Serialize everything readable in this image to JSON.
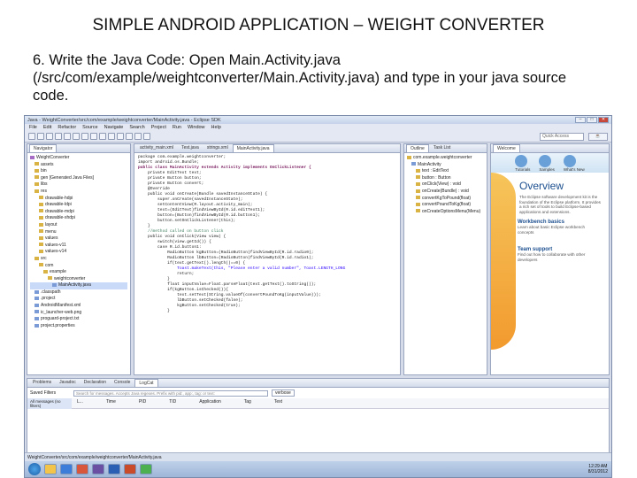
{
  "slide": {
    "title": "SIMPLE ANDROID APPLICATION – WEIGHT CONVERTER",
    "body": "6. Write the Java Code: Open Main.Activity.java (/src/com/example/weightconverter/Main.Activity.java) and type in your java source code."
  },
  "ide": {
    "window_title": "Java - WeightConverter/src/com/example/weightconverter/MainActivity.java - Eclipse SDK",
    "menus": [
      "File",
      "Edit",
      "Refactor",
      "Source",
      "Navigate",
      "Search",
      "Project",
      "Run",
      "Window",
      "Help"
    ],
    "quick_access_placeholder": "Quick Access",
    "navigator": {
      "tab": "Navigator",
      "items": [
        "WeightConverter",
        "assets",
        "bin",
        "gen [Generated Java Files]",
        "libs",
        "res",
        "drawable-hdpi",
        "drawable-ldpi",
        "drawable-mdpi",
        "drawable-xhdpi",
        "layout",
        "menu",
        "values",
        "values-v11",
        "values-v14",
        "src",
        "com",
        "example",
        "weightconverter",
        "MainActivity.java",
        ".classpath",
        ".project",
        "AndroidManifest.xml",
        "ic_launcher-web.png",
        "proguard-project.txt",
        "project.properties"
      ]
    },
    "editor": {
      "tabs": [
        "activity_main.xml",
        "Test.java",
        "strings.xml",
        "MainActivity.java"
      ],
      "lines": [
        "package com.example.weightconverter;",
        "",
        "import android.os.Bundle;",
        "",
        "public class MainActivity extends Activity implements OnClickListener {",
        "    private EditText text;",
        "    private Button button;",
        "    private Button convert;",
        "    @Override",
        "    public void onCreate(Bundle savedInstanceState) {",
        "        super.onCreate(savedInstanceState);",
        "        setContentView(R.layout.activity_main);",
        "        text=(EditText)findViewById(R.id.editText1);",
        "        button=(Button)findViewById(R.id.button1);",
        "        button.setOnClickListener(this);",
        "    }",
        "    //method called on button click",
        "    public void onClick(View view) {",
        "",
        "        switch(view.getId()) {",
        "        case R.id.button1:",
        "            RadioButton kgButton=(RadioButton)findViewById(R.id.radio0);",
        "            RadioButton lbButton=(RadioButton)findViewById(R.id.radio1);",
        "            if(text.getText().length()==0) {",
        "                Toast.makeText(this, \"Please enter a valid number\", Toast.LENGTH_LONG",
        "                return;",
        "            }",
        "            float inputValue=Float.parseFloat(text.getText().toString());",
        "            if(kgButton.isChecked()){",
        "                text.setText(String.valueOf(convertPoundToKg(inputValue)));",
        "                lbButton.setChecked(false);",
        "                kgButton.setChecked(true);",
        "            }"
      ]
    },
    "outline": {
      "tabs": [
        "Outline",
        "Task List"
      ],
      "items": [
        "com.example.weightconverter",
        "MainActivity",
        "text : EditText",
        "button : Button",
        "onClick(View) : void",
        "onCreate(Bundle) : void",
        "convertKgToPound(float)",
        "convertPoundToKg(float)",
        "onCreateOptionsMenu(Menu)"
      ]
    },
    "welcome": {
      "tab": "Welcome",
      "links": [
        "Tutorials",
        "Samples",
        "What's New"
      ],
      "overview_title": "Overview",
      "overview_text": "The Eclipse software development kit is the foundation of the Eclipse platform. It provides a rich set of tools to build Eclipse-based applications and extensions.",
      "items": [
        {
          "title": "Workbench basics",
          "desc": "Learn about basic Eclipse workbench concepts"
        },
        {
          "title": "Team support",
          "desc": "Find out how to collaborate with other developers"
        }
      ]
    },
    "bottom": {
      "tabs": [
        "Problems",
        "Javadoc",
        "Declaration",
        "Console",
        "LogCat"
      ],
      "filter_label": "Saved Filters",
      "filter_item": "All messages (no filters)",
      "search_placeholder": "Search for messages. Accepts Java regexes. Prefix with pid:, app:, tag: or text:",
      "level": "verbose",
      "columns": [
        "L...",
        "Time",
        "PID",
        "TID",
        "Application",
        "Tag",
        "Text"
      ]
    },
    "status": "WeightConverter/src/com/example/weightconverter/MainActivity.java",
    "clock_time": "12:29 AM",
    "clock_date": "8/31/2012"
  }
}
